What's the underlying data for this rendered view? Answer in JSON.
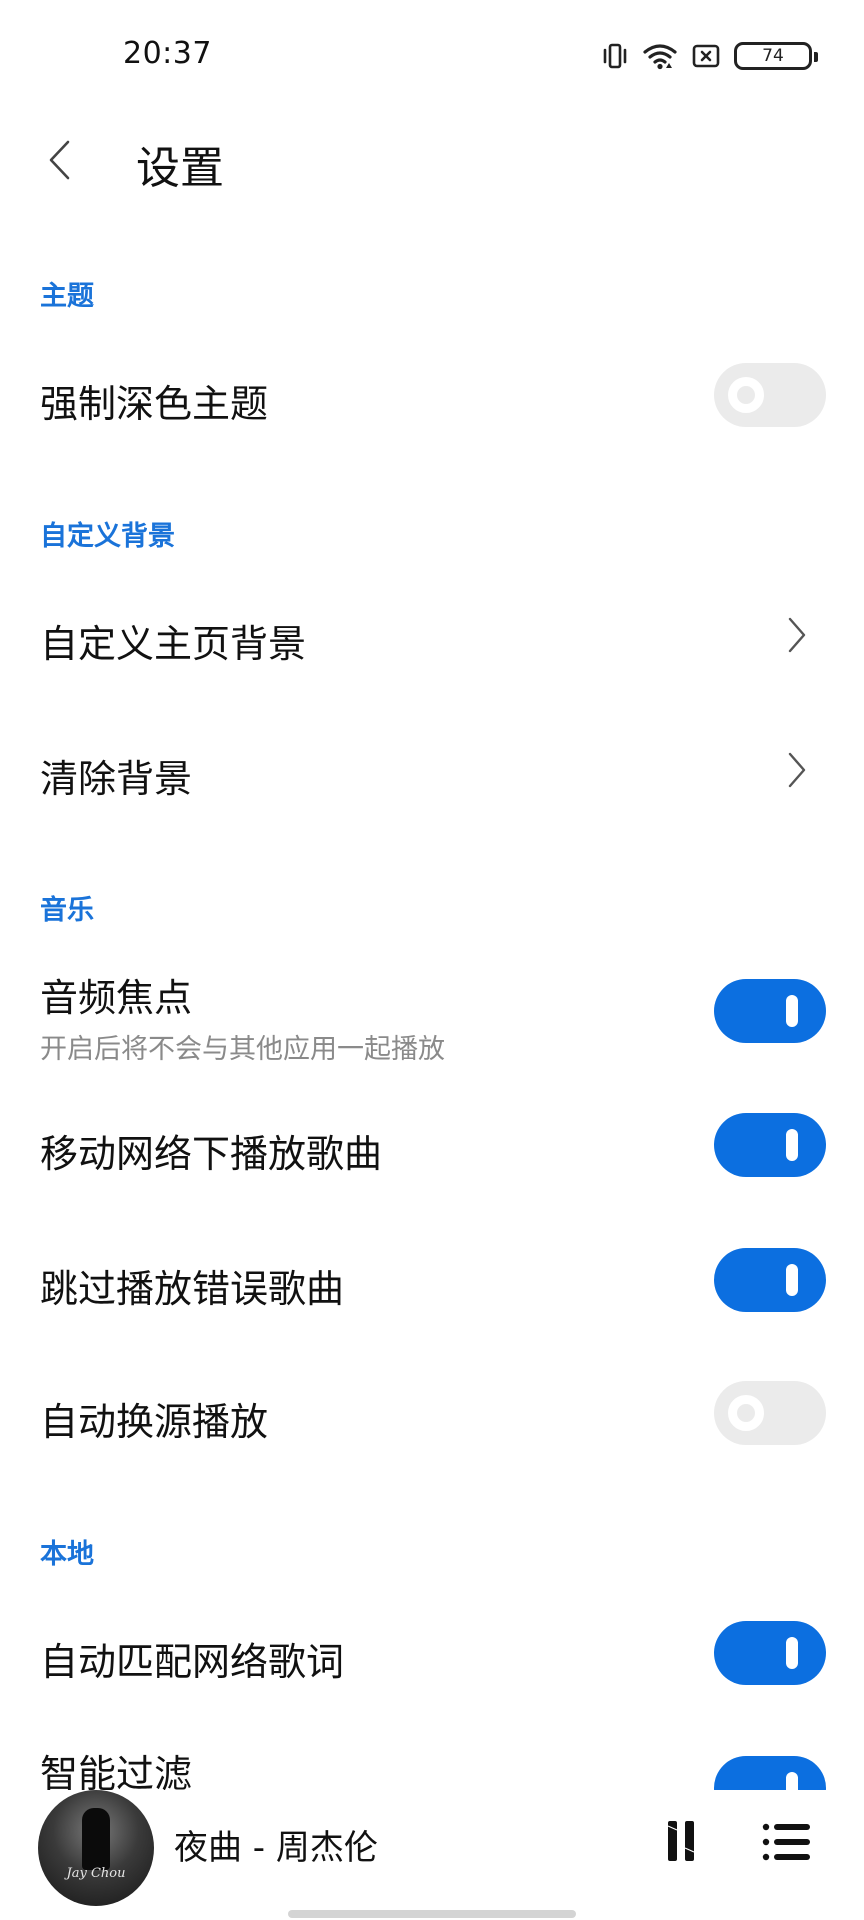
{
  "status_bar": {
    "time": "20:37",
    "battery": "74",
    "icons": [
      "vibrate-icon",
      "wifi-icon",
      "sim-error-icon",
      "battery-icon"
    ]
  },
  "header": {
    "title": "设置",
    "back_icon": "chevron-left-icon"
  },
  "sections": {
    "theme": {
      "title": "主题",
      "force_dark": {
        "label": "强制深色主题",
        "enabled": false
      }
    },
    "background": {
      "title": "自定义背景",
      "custom_home_bg": {
        "label": "自定义主页背景"
      },
      "clear_bg": {
        "label": "清除背景"
      }
    },
    "music": {
      "title": "音乐",
      "audio_focus": {
        "label": "音频焦点",
        "description": "开启后将不会与其他应用一起播放",
        "enabled": true
      },
      "play_on_mobile": {
        "label": "移动网络下播放歌曲",
        "enabled": true
      },
      "skip_errors": {
        "label": "跳过播放错误歌曲",
        "enabled": true
      },
      "auto_switch_source": {
        "label": "自动换源播放",
        "enabled": false
      }
    },
    "local": {
      "title": "本地",
      "auto_lyrics": {
        "label": "自动匹配网络歌词",
        "enabled": true
      },
      "smart_filter": {
        "label": "智能过滤",
        "enabled": true
      }
    }
  },
  "mini_player": {
    "now_playing": "夜曲 - 周杰伦",
    "album_art_text": "Jay Chou",
    "play_pause_icon": "pause-icon",
    "playlist_icon": "playlist-icon"
  },
  "colors": {
    "accent": "#0c6fe0",
    "section_title": "#1a73d9",
    "toggle_off": "#ebebeb",
    "subtitle": "#8a8a8a"
  }
}
